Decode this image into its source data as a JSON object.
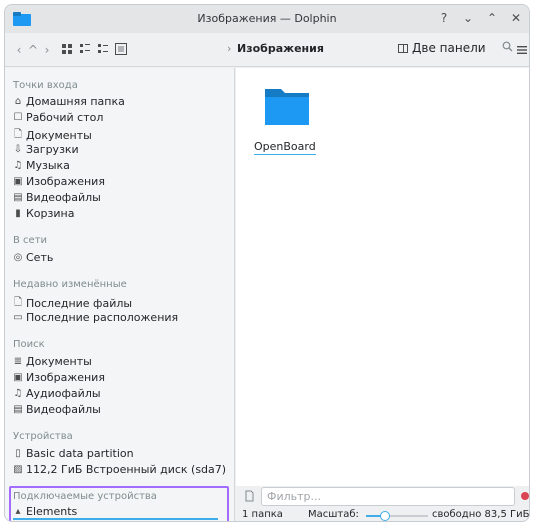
{
  "window": {
    "title": "Изображения — Dolphin",
    "buttons": {
      "help": "?",
      "minimize": "⌄",
      "maximize": "⌃",
      "close": "✕"
    }
  },
  "toolbar": {
    "back": "‹",
    "up": "^",
    "forward": "›",
    "breadcrumb_separator": "›",
    "breadcrumb": "Изображения",
    "split_label": "Две панели",
    "search_icon": "search-icon",
    "menu_icon": "hamburger-menu-icon"
  },
  "sidebar": {
    "places": {
      "title": "Точки входа",
      "items": [
        {
          "icon": "home-icon",
          "glyph": "⌂",
          "label": "Домашняя папка"
        },
        {
          "icon": "desktop-icon",
          "glyph": "☐",
          "label": "Рабочий стол"
        },
        {
          "icon": "documents-icon",
          "glyph": "🗋",
          "label": "Документы"
        },
        {
          "icon": "downloads-icon",
          "glyph": "⇩",
          "label": "Загрузки"
        },
        {
          "icon": "music-icon",
          "glyph": "♫",
          "label": "Музыка"
        },
        {
          "icon": "pictures-icon",
          "glyph": "▣",
          "label": "Изображения"
        },
        {
          "icon": "videos-icon",
          "glyph": "▤",
          "label": "Видеофайлы"
        },
        {
          "icon": "trash-icon",
          "glyph": "▮",
          "label": "Корзина"
        }
      ]
    },
    "network": {
      "title": "В сети",
      "items": [
        {
          "icon": "network-icon",
          "glyph": "◎",
          "label": "Сеть"
        }
      ]
    },
    "recent": {
      "title": "Недавно изменённые",
      "items": [
        {
          "icon": "recent-files-icon",
          "glyph": "🗋",
          "label": "Последние файлы"
        },
        {
          "icon": "recent-locations-icon",
          "glyph": "▭",
          "label": "Последние расположения"
        }
      ]
    },
    "search": {
      "title": "Поиск",
      "items": [
        {
          "icon": "search-documents-icon",
          "glyph": "≣",
          "label": "Документы"
        },
        {
          "icon": "search-images-icon",
          "glyph": "▣",
          "label": "Изображения"
        },
        {
          "icon": "search-audio-icon",
          "glyph": "♫",
          "label": "Аудиофайлы"
        },
        {
          "icon": "search-videos-icon",
          "glyph": "▤",
          "label": "Видеофайлы"
        }
      ]
    },
    "devices": {
      "title": "Устройства",
      "items": [
        {
          "icon": "partition-icon",
          "glyph": "▯",
          "label": "Basic data partition"
        },
        {
          "icon": "disk-icon",
          "glyph": "▨",
          "label": "112,2 ГиБ Встроенный диск (sda7)"
        }
      ]
    },
    "removable": {
      "title": "Подключаемые устройства",
      "items": [
        {
          "icon": "usb-drive-icon",
          "glyph": "▴",
          "label": "Elements"
        }
      ]
    }
  },
  "main": {
    "items": [
      {
        "icon": "folder-icon",
        "label": "OpenBoard"
      }
    ]
  },
  "filter": {
    "placeholder": "Фильтр..."
  },
  "status": {
    "count": "1 папка",
    "zoom_label": "Масштаб:",
    "zoom_level": 0.3,
    "free_space": "свободно 83,5 ГиБ"
  },
  "colors": {
    "accent": "#3daee9",
    "highlight_box": "#a46bff",
    "folder": "#1d99f3",
    "folder_dark": "#147bc4",
    "close": "#da4453"
  }
}
